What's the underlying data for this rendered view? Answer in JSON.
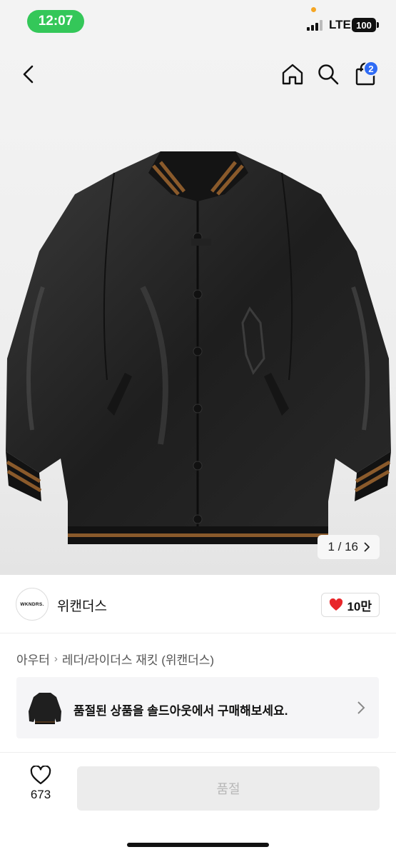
{
  "status_bar": {
    "time": "12:07",
    "network": "LTE",
    "battery": "100"
  },
  "nav": {
    "cart_badge": "2",
    "icons": [
      "back-icon",
      "home-icon",
      "search-icon",
      "bag-icon"
    ]
  },
  "gallery": {
    "pager": "1 / 16"
  },
  "brand": {
    "logo_text": "WKNDRS.",
    "name": "위캔더스",
    "likes": "10만",
    "like_color": "#e8262a"
  },
  "breadcrumb": {
    "category": "아우터",
    "subcategory": "레더/라이더스 재킷 (위캔더스)"
  },
  "banner": {
    "text": "품절된 상품을 솔드아웃에서 구매해보세요."
  },
  "bottom": {
    "wish_count": "673",
    "buy_label": "품절"
  },
  "colors": {
    "status_green": "#34c759",
    "badge_blue": "#2f6bf5",
    "stripe_brown": "#8a5a2b"
  }
}
